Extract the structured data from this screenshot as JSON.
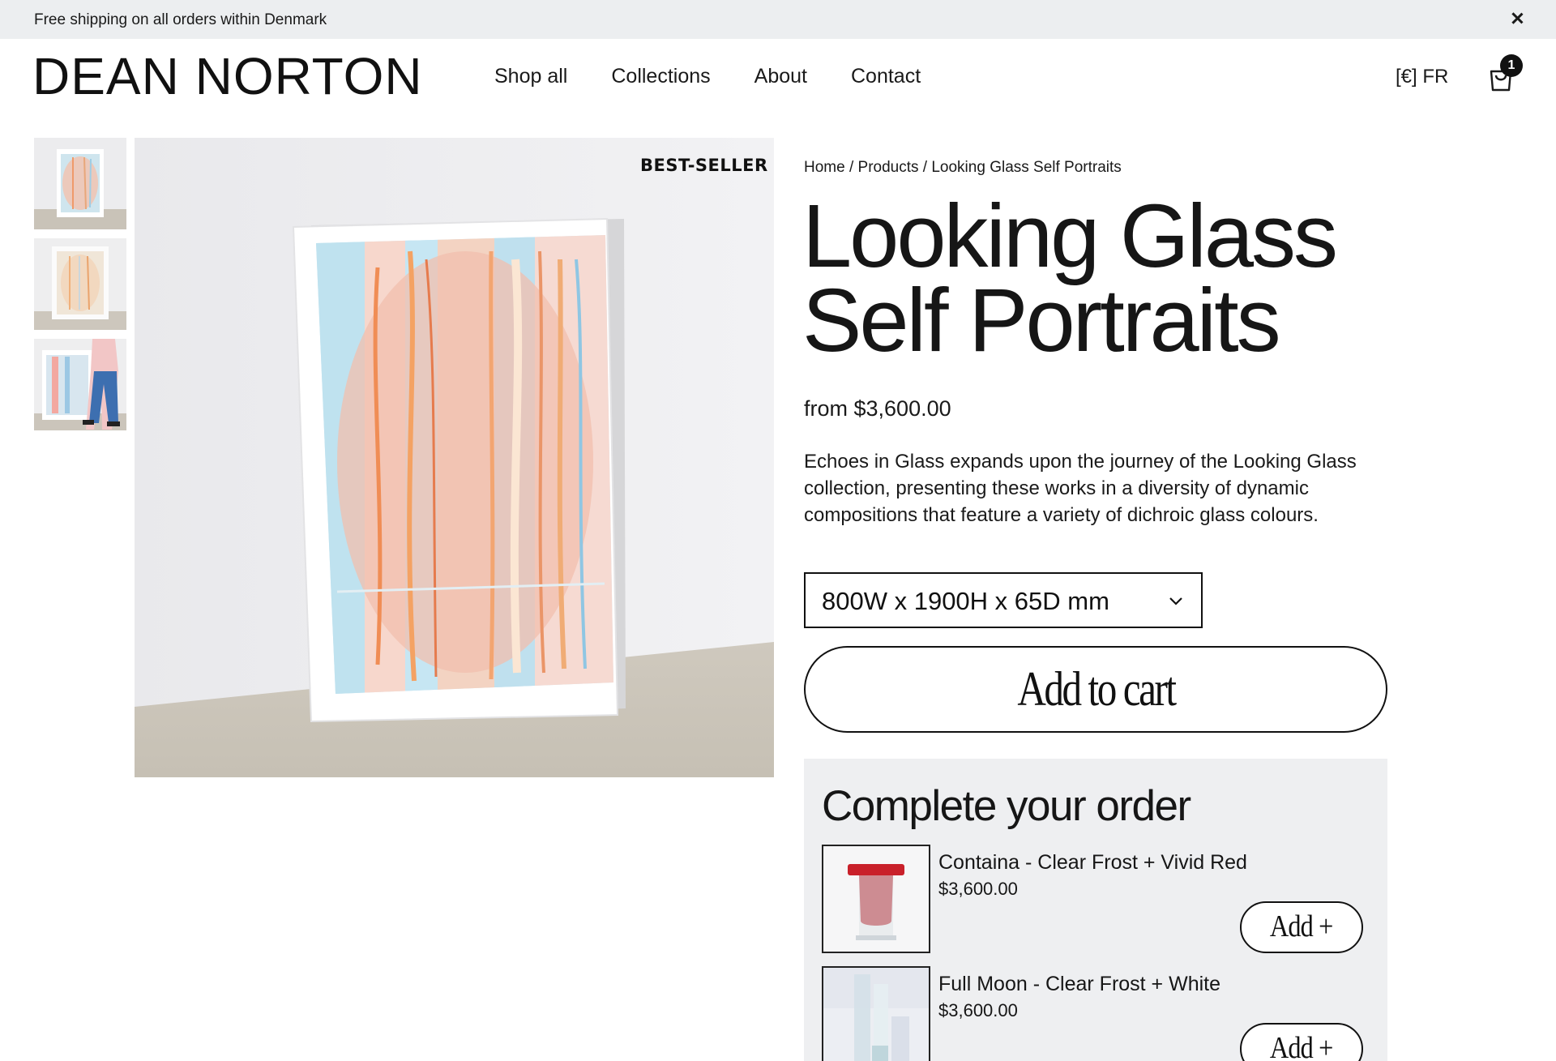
{
  "announcement": {
    "text": "Free shipping on all orders within Denmark"
  },
  "header": {
    "logo": "DEAN NORTON",
    "nav": [
      {
        "label": "Shop all"
      },
      {
        "label": "Collections"
      },
      {
        "label": "About"
      },
      {
        "label": "Contact"
      }
    ],
    "locale": "[€] FR",
    "cart_count": "1"
  },
  "gallery": {
    "badge": "BEST-SELLER",
    "thumbnails": [
      "framed-glass-front",
      "framed-glass-angle",
      "glass-with-person"
    ]
  },
  "breadcrumb": {
    "home": "Home",
    "sep1": "/",
    "products": "Products",
    "sep2": "/",
    "current": "Looking Glass Self Portraits"
  },
  "product": {
    "title_line1": "Looking Glass",
    "title_line2": "Self Portraits",
    "price": "from $3,600.00",
    "description": "Echoes in Glass expands upon the journey of the Looking Glass collection, presenting these works in a diversity of dynamic compositions that feature a variety of dichroic glass colours.",
    "variant": "800W x 1900H x 65D mm",
    "add_to_cart": "Add to cart"
  },
  "upsell": {
    "title": "Complete your order",
    "items": [
      {
        "name": "Containa - Clear Frost + Vivid Red",
        "price": "$3,600.00",
        "add": "Add +"
      },
      {
        "name": "Full Moon - Clear Frost + White",
        "price": "$3,600.00",
        "add": "Add +"
      }
    ]
  },
  "colors": {
    "announcement_bg": "#eceef0",
    "upsell_bg": "#eeeff1",
    "text": "#1a1a1a"
  }
}
